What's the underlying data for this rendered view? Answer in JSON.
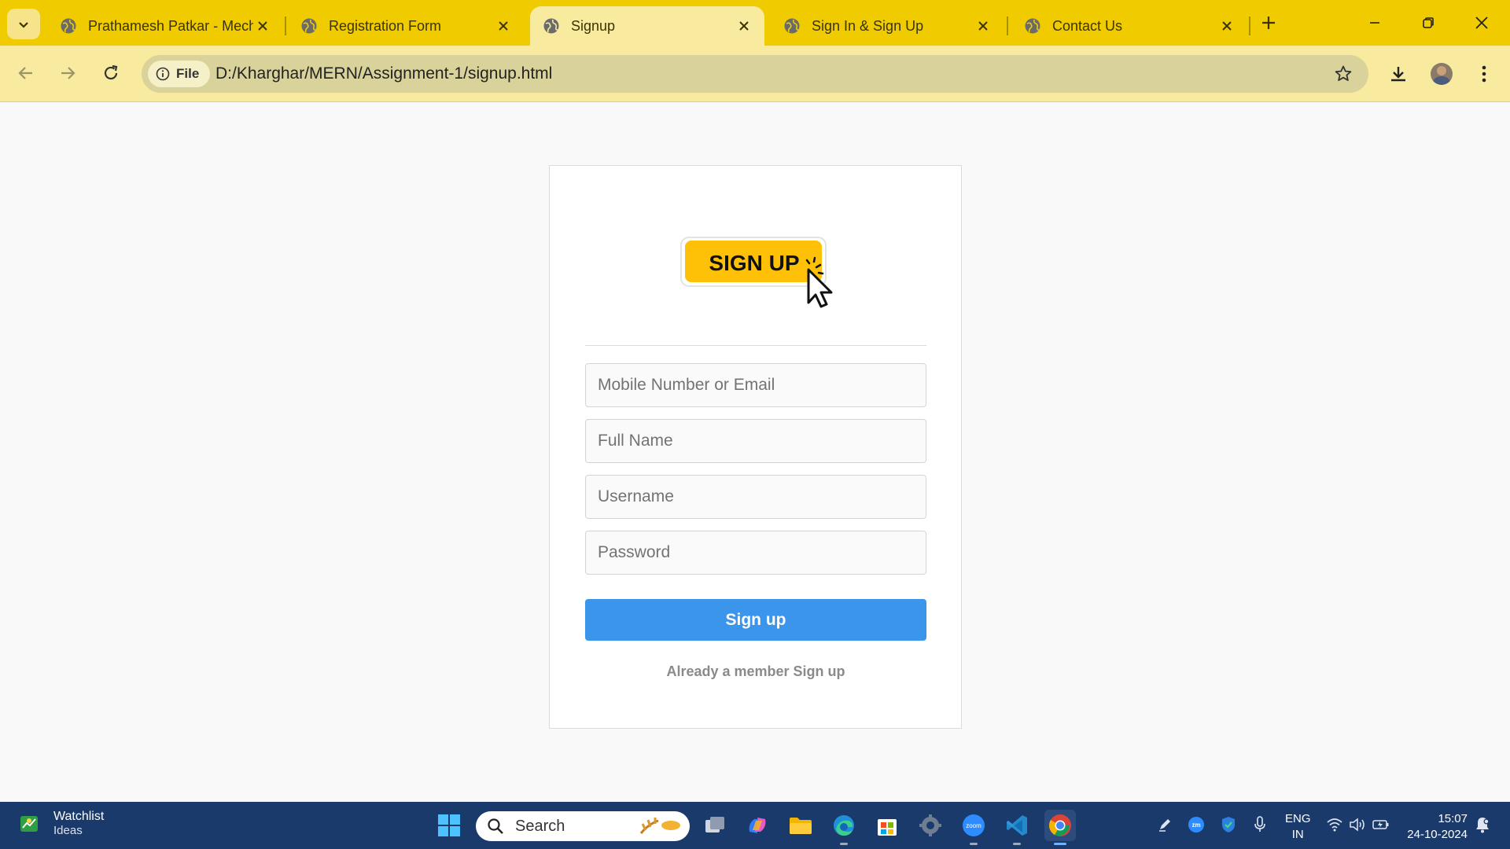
{
  "browser": {
    "tabs": [
      {
        "title": "Prathamesh Patkar - Mecha",
        "active": false
      },
      {
        "title": "Registration Form",
        "active": false
      },
      {
        "title": "Signup",
        "active": true
      },
      {
        "title": "Sign In & Sign Up",
        "active": false
      },
      {
        "title": "Contact Us",
        "active": false
      }
    ],
    "address_chip": "File",
    "url": "D:/Kharghar/MERN/Assignment-1/signup.html"
  },
  "page": {
    "logo_text": "SIGN UP",
    "fields": [
      {
        "name": "mobile-email-input",
        "placeholder": "Mobile Number or Email"
      },
      {
        "name": "full-name-input",
        "placeholder": "Full Name"
      },
      {
        "name": "username-input",
        "placeholder": "Username"
      },
      {
        "name": "password-input",
        "placeholder": "Password"
      }
    ],
    "submit_label": "Sign up",
    "member_text": "Already a member Sign up"
  },
  "taskbar": {
    "widget_title": "Watchlist",
    "widget_subtitle": "Ideas",
    "search_placeholder": "Search",
    "lang_top": "ENG",
    "lang_bottom": "IN",
    "time": "15:07",
    "date": "24-10-2024"
  },
  "colors": {
    "tab_strip": "#efcb00",
    "toolbar": "#f8ea9e",
    "submit_button": "#3b96eb",
    "taskbar": "#1a3a6c"
  }
}
